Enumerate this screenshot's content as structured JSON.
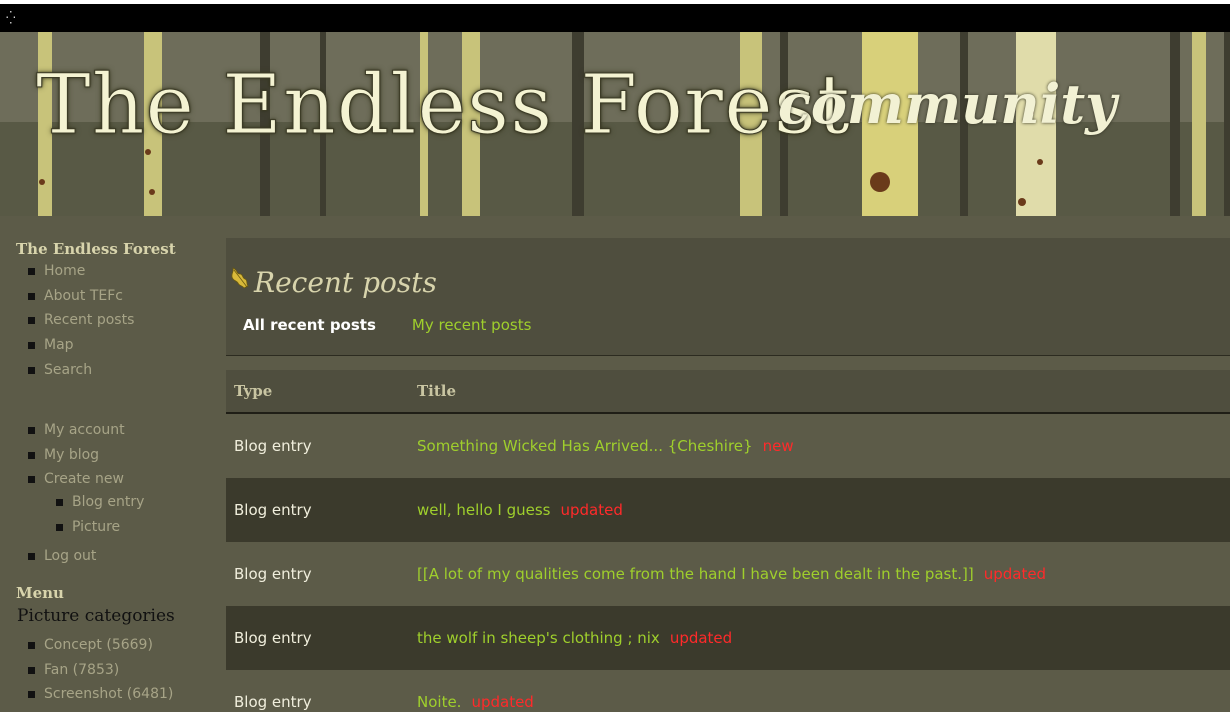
{
  "banner": {
    "title": "The Endless Forest",
    "subtitle": "community"
  },
  "sidebar": {
    "heading": "The Endless Forest",
    "nav": [
      "Home",
      "About TEFc",
      "Recent posts",
      "Map",
      "Search"
    ],
    "account": [
      "My account",
      "My blog",
      "Create new"
    ],
    "create_sub": [
      "Blog entry",
      "Picture"
    ],
    "logout": "Log out",
    "menu_heading": "Menu",
    "categories_heading": "Picture categories",
    "categories": [
      "Concept (5669)",
      "Fan (7853)",
      "Screenshot (6481)"
    ]
  },
  "main": {
    "title": "Recent posts",
    "tabs": [
      "All recent posts",
      "My recent posts"
    ],
    "columns": [
      "Type",
      "Title"
    ],
    "rows": [
      {
        "type": "Blog entry",
        "title": "Something Wicked Has Arrived... {Cheshire}",
        "mark": "new"
      },
      {
        "type": "Blog entry",
        "title": "well, hello I guess",
        "mark": "updated"
      },
      {
        "type": "Blog entry",
        "title": "[[A lot of my qualities come from the hand I have been dealt in the past.]]",
        "mark": "updated"
      },
      {
        "type": "Blog entry",
        "title": "the wolf in sheep's clothing ; nix",
        "mark": "updated"
      },
      {
        "type": "Blog entry",
        "title": "Noite.",
        "mark": "updated"
      }
    ]
  }
}
